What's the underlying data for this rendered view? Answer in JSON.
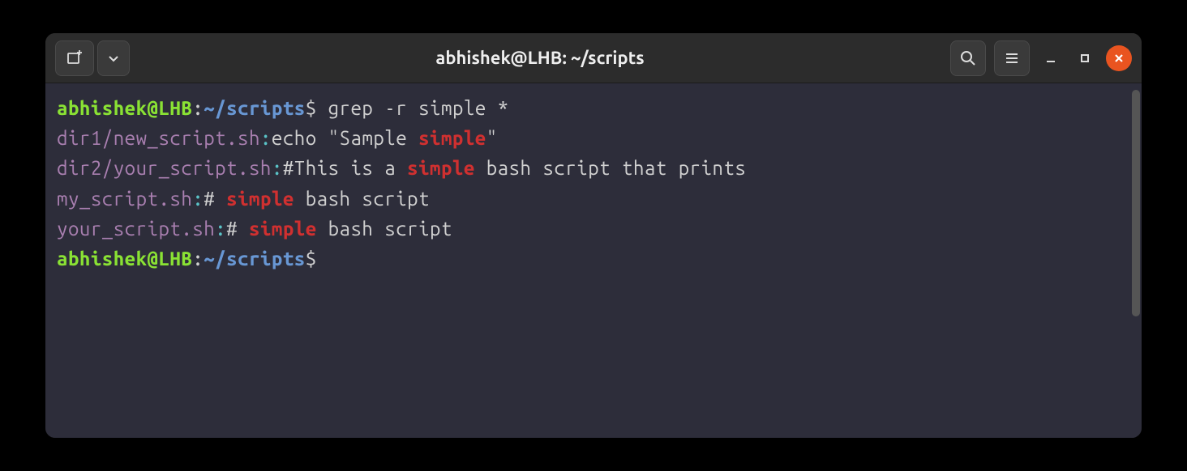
{
  "window": {
    "title": "abhishek@LHB: ~/scripts"
  },
  "prompt": {
    "user_host": "abhishek@LHB",
    "colon": ":",
    "path": "~/scripts",
    "dollar": "$"
  },
  "command": "grep -r simple *",
  "output": {
    "line1": {
      "file": "dir1/new_script.sh",
      "colon": ":",
      "before": "echo \"Sample ",
      "match": "simple",
      "after": "\""
    },
    "line2": {
      "file": "dir2/your_script.sh",
      "colon": ":",
      "before": "#This is a ",
      "match": "simple",
      "after": " bash script that prints"
    },
    "line3": {
      "file": "my_script.sh",
      "colon": ":",
      "before": "# ",
      "match": "simple",
      "after": " bash script"
    },
    "line4": {
      "file": "your_script.sh",
      "colon": ":",
      "before": "# ",
      "match": "simple",
      "after": " bash script"
    }
  },
  "colors": {
    "prompt_user": "#8ae234",
    "prompt_path": "#6897d4",
    "grep_file": "#a97fb0",
    "grep_colon": "#5ac3c7",
    "grep_match": "#d03030",
    "close_button": "#e95420",
    "terminal_bg": "#2d2d3a"
  }
}
